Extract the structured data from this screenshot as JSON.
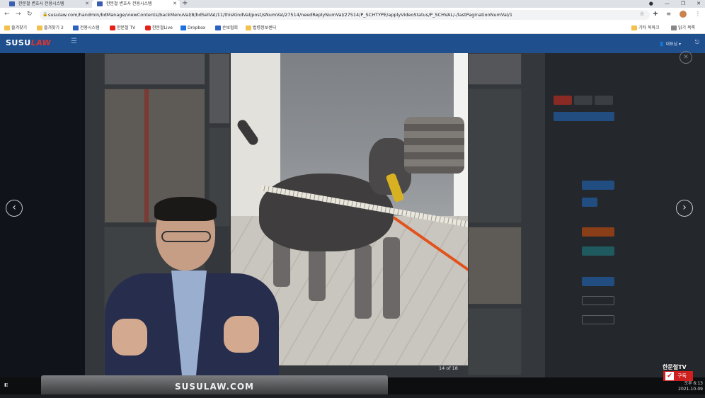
{
  "browser": {
    "tabs": [
      {
        "label": "한문철 변호사 전용시스템",
        "active": false
      },
      {
        "label": "한문철 변호사 전용시스템",
        "active": true
      }
    ],
    "url": "susulaw.com/handmin/bdManage/viewContents/backMenuVal/8/bdSelVal/11/thisKindVal/post/sNumVal/27514/needReplyNumVal/27514/P_SCHTYPE/applyVideoStatus/P_SCHVAL/-/lastPaginationNumVal/1",
    "bookmarks": [
      {
        "label": "즐겨찾기",
        "icon": "folder-icon"
      },
      {
        "label": "즐겨찾기 2",
        "icon": "folder-icon"
      },
      {
        "label": "전용시스템",
        "icon": "site-icon"
      },
      {
        "label": "한문철 TV",
        "icon": "youtube-icon"
      },
      {
        "label": "한문철Live",
        "icon": "youtube-icon"
      },
      {
        "label": "Dropbox",
        "icon": "dropbox-icon"
      },
      {
        "label": "손보협회",
        "icon": "site-icon"
      },
      {
        "label": "법령정보센터",
        "icon": "folder-icon"
      }
    ],
    "bookmarks_right": [
      {
        "label": "기타 북마크",
        "icon": "folder-icon"
      },
      {
        "label": "읽기 목록",
        "icon": "reading-list-icon"
      }
    ]
  },
  "site": {
    "logo_main": "SUSU",
    "logo_accent": "LAW",
    "user_label": "대표님"
  },
  "lightbox": {
    "counter": "14 of 18"
  },
  "overlay": {
    "banner": "SUSULAW.COM",
    "channel": "한문철TV",
    "subscribe": "구독",
    "time": "오후 6:13",
    "date": "2021-10-09"
  },
  "colors": {
    "header": "#1f4f8d",
    "logo_accent": "#e2332c",
    "subscribe": "#cf1f1f"
  }
}
